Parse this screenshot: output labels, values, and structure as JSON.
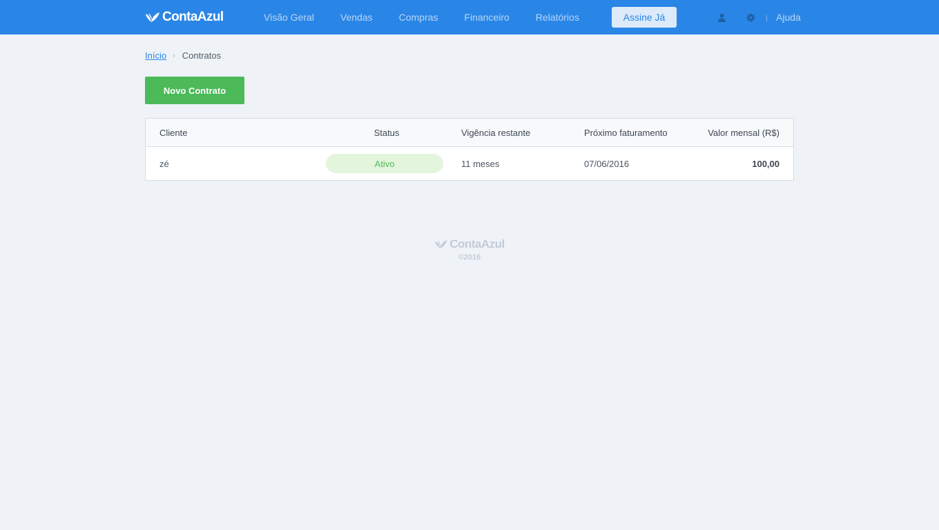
{
  "header": {
    "logo_text": "ContaAzul",
    "nav_items": [
      {
        "label": "Visão Geral"
      },
      {
        "label": "Vendas"
      },
      {
        "label": "Compras"
      },
      {
        "label": "Financeiro"
      },
      {
        "label": "Relatórios"
      }
    ],
    "subscribe_label": "Assine Já",
    "user_icon": "user-icon",
    "settings_icon": "gear-icon",
    "help_label": "Ajuda"
  },
  "breadcrumb": {
    "home_label": "Início",
    "separator": "›",
    "current_label": "Contratos"
  },
  "actions": {
    "new_contract_label": "Novo Contrato"
  },
  "table": {
    "columns": {
      "client": "Cliente",
      "status": "Status",
      "term": "Vigência restante",
      "next_billing": "Próximo faturamento",
      "monthly_value": "Valor mensal (R$)"
    },
    "rows": [
      {
        "client": "zé",
        "status": "Ativo",
        "term": "11 meses",
        "next_billing": "07/06/2016",
        "monthly_value": "100,00"
      }
    ]
  },
  "footer": {
    "logo_text": "ContaAzul",
    "copyright": "©2016"
  },
  "colors": {
    "header_bg": "#2a86e6",
    "page_bg": "#eff3f8",
    "primary_green": "#4cba58",
    "status_active_bg": "#e4f5de",
    "link_blue": "#2a86e6"
  }
}
